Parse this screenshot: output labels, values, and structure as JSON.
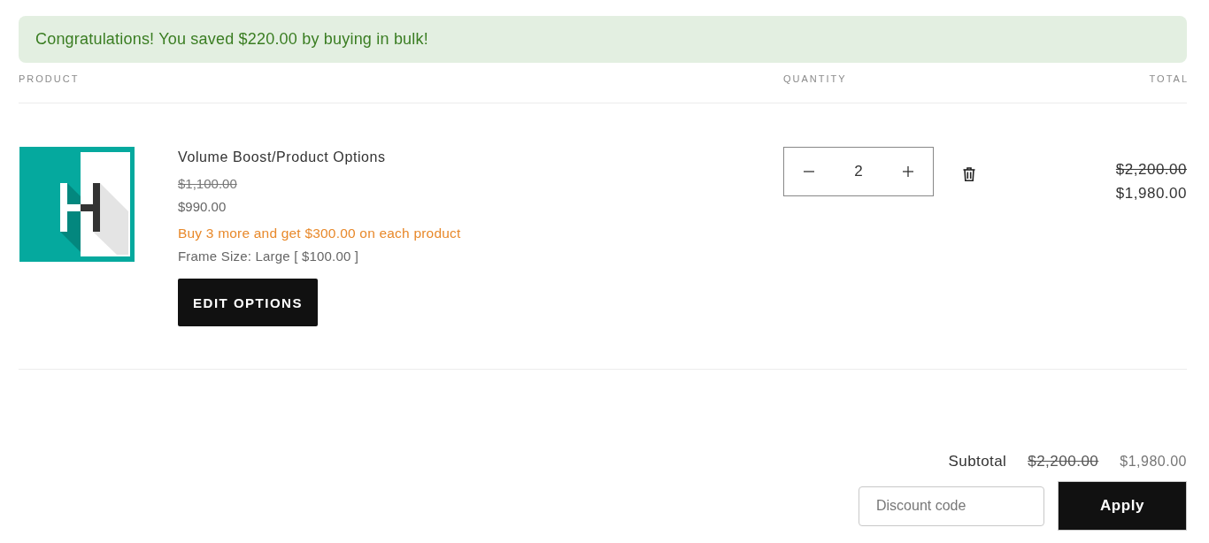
{
  "banner": {
    "message": "Congratulations! You saved $220.00 by buying in bulk!"
  },
  "table": {
    "columns": [
      "PRODUCT",
      "QUANTITY",
      "TOTAL"
    ],
    "rows": [
      {
        "title": "Volume Boost/Product Options",
        "original_price": "$1,100.00",
        "price": "$990.00",
        "offer": "Buy 3 more and get $300.00 on each product",
        "option": "Frame Size: Large [ $100.00 ]",
        "button": "EDIT OPTIONS",
        "quantity": "2",
        "original_total": "$2,200.00",
        "total": "$1,980.00"
      }
    ]
  },
  "summary": {
    "label": "Subtotal",
    "original_total": "$2,200.00",
    "total": "$1,980.00",
    "discount": {
      "placeholder": "Discount code"
    },
    "button": "Apply"
  }
}
